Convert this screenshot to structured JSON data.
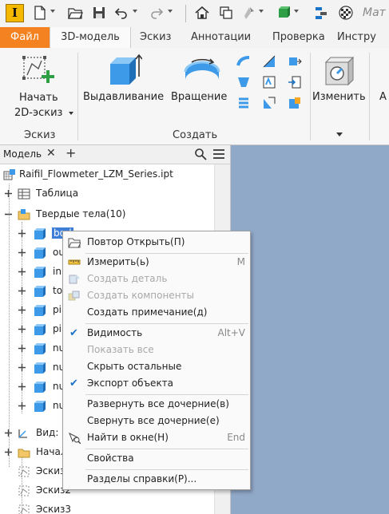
{
  "app": {
    "logo_letter": "I",
    "material_label": "Мат"
  },
  "ribbon_tabs": [
    "Файл",
    "3D-модель",
    "Эскиз",
    "Аннотации",
    "Проверка",
    "Инстру"
  ],
  "ribbon": {
    "start_sketch_line1": "Начать",
    "start_sketch_line2": "2D-эскиз",
    "extrude": "Выдавливание",
    "revolve": "Вращение",
    "modify": "Изменить",
    "partial_next": "А",
    "group_sketch": "Эскиз",
    "group_create": "Создать"
  },
  "browser": {
    "tab_label": "Модель",
    "close_glyph": "✕",
    "add_glyph": "+",
    "tree": [
      {
        "label": "Raifil_Flowmeter_LZM_Series.ipt"
      },
      {
        "label": "Таблица"
      },
      {
        "label": "Твердые тела(10)"
      },
      {
        "label": "bod"
      },
      {
        "label": "ou"
      },
      {
        "label": "inp"
      },
      {
        "label": "top"
      },
      {
        "label": "pin"
      },
      {
        "label": "pin"
      },
      {
        "label": "nu"
      },
      {
        "label": "nu"
      },
      {
        "label": "nu"
      },
      {
        "label": "nu"
      },
      {
        "label": "Вид: ["
      },
      {
        "label": "Начал"
      },
      {
        "label": "Эскиз"
      },
      {
        "label": "Эскиз2"
      },
      {
        "label": "Эскиз3"
      }
    ]
  },
  "context_menu": {
    "items": [
      {
        "label": "Повтор Открыть(П)",
        "shortcut": ""
      },
      {
        "label": "Измерить(ь)",
        "shortcut": "M"
      },
      {
        "label": "Создать деталь",
        "shortcut": ""
      },
      {
        "label": "Создать компоненты",
        "shortcut": ""
      },
      {
        "label": "Создать примечание(д)",
        "shortcut": ""
      },
      {
        "label": "Видимость",
        "shortcut": "Alt+V"
      },
      {
        "label": "Показать все",
        "shortcut": ""
      },
      {
        "label": "Скрыть остальные",
        "shortcut": ""
      },
      {
        "label": "Экспорт объекта",
        "shortcut": ""
      },
      {
        "label": "Развернуть все дочерние(в)",
        "shortcut": ""
      },
      {
        "label": "Свернуть все дочерние(е)",
        "shortcut": ""
      },
      {
        "label": "Найти в окне(Н)",
        "shortcut": "End"
      },
      {
        "label": "Свойства",
        "shortcut": ""
      },
      {
        "label": "Разделы справки(P)...",
        "shortcut": ""
      }
    ],
    "check_glyph": "✔"
  },
  "colors": {
    "file_tab": "#f58220",
    "canvas": "#91a9c9",
    "body_icon": "#3d9ae8",
    "check": "#1a73c8"
  },
  "icons": [
    "app-logo-icon",
    "new-file-icon",
    "open-folder-icon",
    "save-icon",
    "undo-icon",
    "redo-icon",
    "home-icon",
    "return-icon",
    "update-icon",
    "3d-box-icon",
    "parameters-icon",
    "material-sphere-icon",
    "sketch-icon",
    "extrude-icon",
    "revolve-icon",
    "modify-icon",
    "search-icon",
    "menu-icon",
    "part-file-icon",
    "table-icon",
    "folder-icon",
    "solid-body-icon",
    "view-icon",
    "origin-folder-icon",
    "sketch-item-icon",
    "reopen-icon",
    "measure-icon",
    "create-part-icon",
    "create-components-icon",
    "find-in-window-icon"
  ]
}
